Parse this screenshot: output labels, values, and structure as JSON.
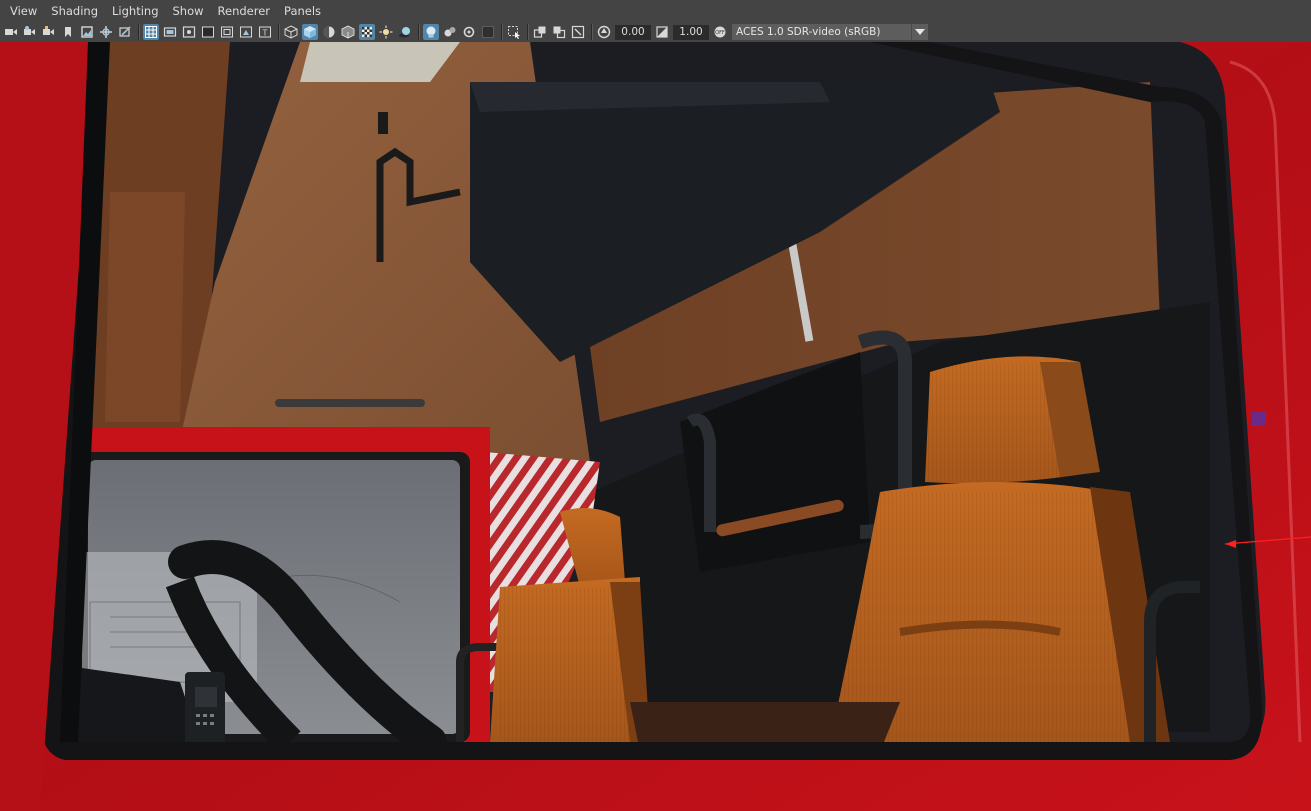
{
  "menubar": {
    "items": [
      "View",
      "Shading",
      "Lighting",
      "Show",
      "Renderer",
      "Panels"
    ]
  },
  "toolbar": {
    "exposure_value": "0.00",
    "gamma_value": "1.00",
    "color_space": "ACES 1.0 SDR-video (sRGB)",
    "accent_color": "#5285a6"
  },
  "viewport": {
    "scene": "truck cab interior",
    "cab_color": "#c8121a",
    "seat_color": "#b8621e",
    "wall_color": "#8a5a3a"
  }
}
